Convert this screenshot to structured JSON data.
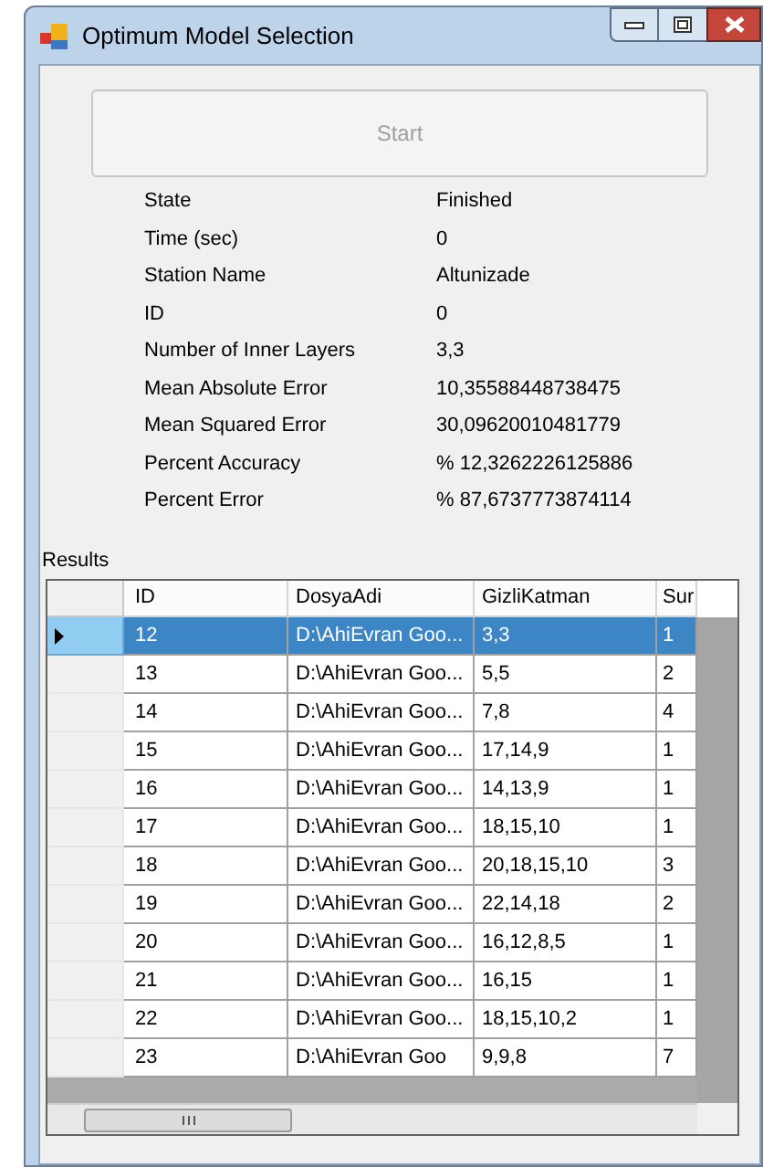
{
  "window": {
    "title": "Optimum Model Selection"
  },
  "start_button": {
    "label": "Start",
    "disabled": true
  },
  "fields": [
    {
      "label": "State",
      "value": "Finished"
    },
    {
      "label": "Time (sec)",
      "value": "0"
    },
    {
      "label": "Station Name",
      "value": "Altunizade"
    },
    {
      "label": "ID",
      "value": "0"
    },
    {
      "label": "Number of Inner Layers",
      "value": "3,3"
    },
    {
      "label": "Mean Absolute Error",
      "value": "10,35588448738475"
    },
    {
      "label": "Mean Squared Error",
      "value": "30,09620010481779"
    },
    {
      "label": "Percent Accuracy",
      "value": "% 12,3262226125886"
    },
    {
      "label": "Percent Error",
      "value": "% 87,6737773874114"
    }
  ],
  "results": {
    "label": "Results",
    "columns": [
      "ID",
      "DosyaAdi",
      "GizliKatman",
      "Sur"
    ],
    "rows": [
      {
        "cells": [
          "12",
          "D:\\AhiEvran Goo...",
          "3,3",
          "1"
        ],
        "selected": true
      },
      {
        "cells": [
          "13",
          "D:\\AhiEvran Goo...",
          "5,5",
          "2"
        ],
        "selected": false
      },
      {
        "cells": [
          "14",
          "D:\\AhiEvran Goo...",
          "7,8",
          "4"
        ],
        "selected": false
      },
      {
        "cells": [
          "15",
          "D:\\AhiEvran Goo...",
          "17,14,9",
          "1"
        ],
        "selected": false
      },
      {
        "cells": [
          "16",
          "D:\\AhiEvran Goo...",
          "14,13,9",
          "1"
        ],
        "selected": false
      },
      {
        "cells": [
          "17",
          "D:\\AhiEvran Goo...",
          "18,15,10",
          "1"
        ],
        "selected": false
      },
      {
        "cells": [
          "18",
          "D:\\AhiEvran Goo...",
          "20,18,15,10",
          "3"
        ],
        "selected": false
      },
      {
        "cells": [
          "19",
          "D:\\AhiEvran Goo...",
          "22,14,18",
          "2"
        ],
        "selected": false
      },
      {
        "cells": [
          "20",
          "D:\\AhiEvran Goo...",
          "16,12,8,5",
          "1"
        ],
        "selected": false
      },
      {
        "cells": [
          "21",
          "D:\\AhiEvran Goo...",
          "16,15",
          "1"
        ],
        "selected": false
      },
      {
        "cells": [
          "22",
          "D:\\AhiEvran Goo...",
          "18,15,10,2",
          "1"
        ],
        "selected": false
      },
      {
        "cells": [
          "23",
          "D:\\AhiEvran Goo",
          "9,9,8",
          "7"
        ],
        "selected": false
      }
    ]
  }
}
